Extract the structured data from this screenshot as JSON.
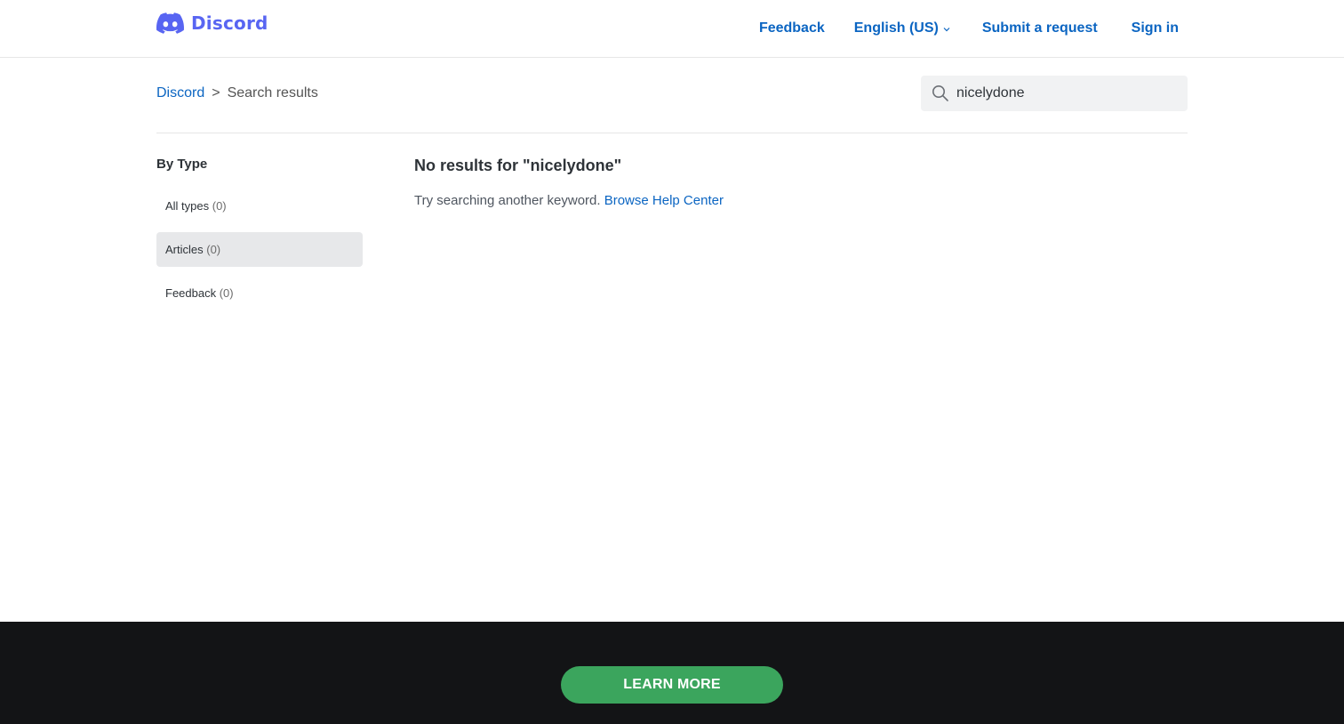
{
  "header": {
    "logo_text": "Discord",
    "nav": {
      "feedback": "Feedback",
      "language": "English (US)",
      "submit_request": "Submit a request",
      "sign_in": "Sign in"
    }
  },
  "breadcrumb": {
    "home": "Discord",
    "separator": ">",
    "current": "Search results"
  },
  "search": {
    "value": "nicelydone",
    "placeholder": "Search"
  },
  "sidebar": {
    "heading": "By Type",
    "items": [
      {
        "label": "All types",
        "count": "(0)",
        "active": false
      },
      {
        "label": "Articles",
        "count": "(0)",
        "active": true
      },
      {
        "label": "Feedback",
        "count": "(0)",
        "active": false
      }
    ]
  },
  "results": {
    "title": "No results for \"nicelydone\"",
    "hint": "Try searching another keyword.",
    "browse_link": "Browse Help Center"
  },
  "footer": {
    "cta": "LEARN MORE"
  },
  "colors": {
    "brand": "#5865f2",
    "link": "#0b65c2",
    "footer_bg": "#131416",
    "cta": "#3ba55d",
    "active_filter_bg": "#e7e8ea"
  }
}
